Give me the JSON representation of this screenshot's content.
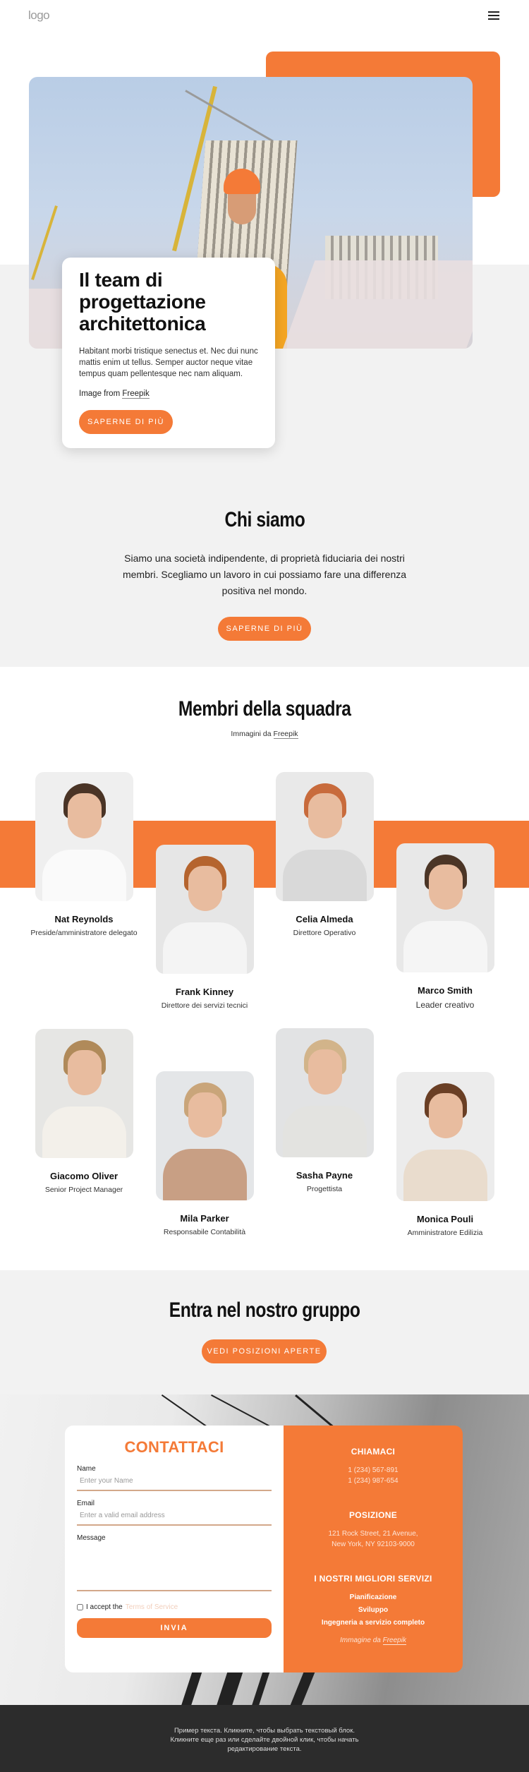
{
  "header": {
    "logo": "logo",
    "menu_icon": "hamburger-menu-icon"
  },
  "hero": {
    "title": "Il team di progettazione architettonica",
    "text": "Habitant morbi tristique senectus et. Nec dui nunc mattis enim ut tellus. Semper auctor neque vitae tempus quam pellentesque nec nam aliquam.",
    "credit_prefix": "Image from",
    "credit_link": "Freepik",
    "button": "SAPERNE DI PIÙ"
  },
  "about": {
    "title": "Chi siamo",
    "text": "Siamo una società indipendente, di proprietà fiduciaria dei nostri membri. Scegliamo un lavoro in cui possiamo fare una differenza positiva nel mondo.",
    "button": "SAPERNE DI PIÙ"
  },
  "team": {
    "title": "Membri della squadra",
    "credit_prefix": "Immagini da",
    "credit_link": "Freepik",
    "members": [
      {
        "name": "Nat Reynolds",
        "role": "Preside/amministratore delegato"
      },
      {
        "name": "Frank Kinney",
        "role": "Direttore dei servizi tecnici"
      },
      {
        "name": "Celia Almeda",
        "role": "Direttore Operativo"
      },
      {
        "name": "Marco Smith",
        "role": "Leader creativo"
      },
      {
        "name": "Giacomo Oliver",
        "role": "Senior Project Manager"
      },
      {
        "name": "Mila Parker",
        "role": "Responsabile Contabilità"
      },
      {
        "name": "Sasha Payne",
        "role": "Progettista"
      },
      {
        "name": "Monica Pouli",
        "role": "Amministratore Edilizia"
      }
    ]
  },
  "join": {
    "title": "Entra nel nostro gruppo",
    "button": "VEDI POSIZIONI APERTE"
  },
  "contact": {
    "title": "CONTATTACI",
    "name_label": "Name",
    "name_placeholder": "Enter your Name",
    "email_label": "Email",
    "email_placeholder": "Enter a valid email address",
    "message_label": "Message",
    "terms_prefix": "I accept the",
    "terms_link": "Terms of Service",
    "submit": "INVIA"
  },
  "info": {
    "call_title": "CHIAMACI",
    "phones": [
      "1 (234) 567-891",
      "1 (234) 987-654"
    ],
    "location_title": "POSIZIONE",
    "address_line1": "121 Rock Street, 21 Avenue,",
    "address_line2": "New York, NY 92103-9000",
    "services_title": "I NOSTRI MIGLIORI SERVIZI",
    "services": [
      "Pianificazione",
      "Sviluppo",
      "Ingegneria a servizio completo"
    ],
    "credit_prefix": "Immagine da",
    "credit_link": "Freepik"
  },
  "footer": {
    "text": "Пример текста. Кликните, чтобы выбрать текстовый блок. Кликните еще раз или сделайте двойной клик, чтобы начать редактирование текста."
  },
  "colors": {
    "accent": "#f47a37",
    "light_bg": "#f2f2f2",
    "footer_bg": "#2c2c2c"
  }
}
